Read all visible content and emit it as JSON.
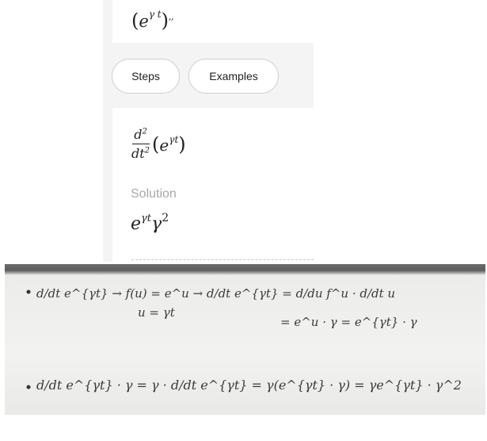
{
  "input": {
    "base": "e",
    "exp": "γ t",
    "prime": "′′"
  },
  "buttons": {
    "steps": "Steps",
    "examples": "Examples"
  },
  "problem": {
    "num": "d",
    "num_exp": "2",
    "den": "dt",
    "den_exp": "2",
    "base": "e",
    "exp": "γt"
  },
  "solution": {
    "label": "Solution",
    "base": "e",
    "exp1": "γt",
    "gamma": "γ",
    "exp2": "2"
  },
  "notes": {
    "line1a": "d/dt e^{γt} → f(u) = e^u → d/dt e^{γt} = d/du f^u · d/dt u",
    "line1b": "u = γt",
    "line1c": "= e^u · γ = e^{γt} · γ",
    "line2": "d/dt e^{γt} · γ = γ · d/dt e^{γt} = γ(e^{γt} · γ) = γe^{γt} · γ^2"
  }
}
